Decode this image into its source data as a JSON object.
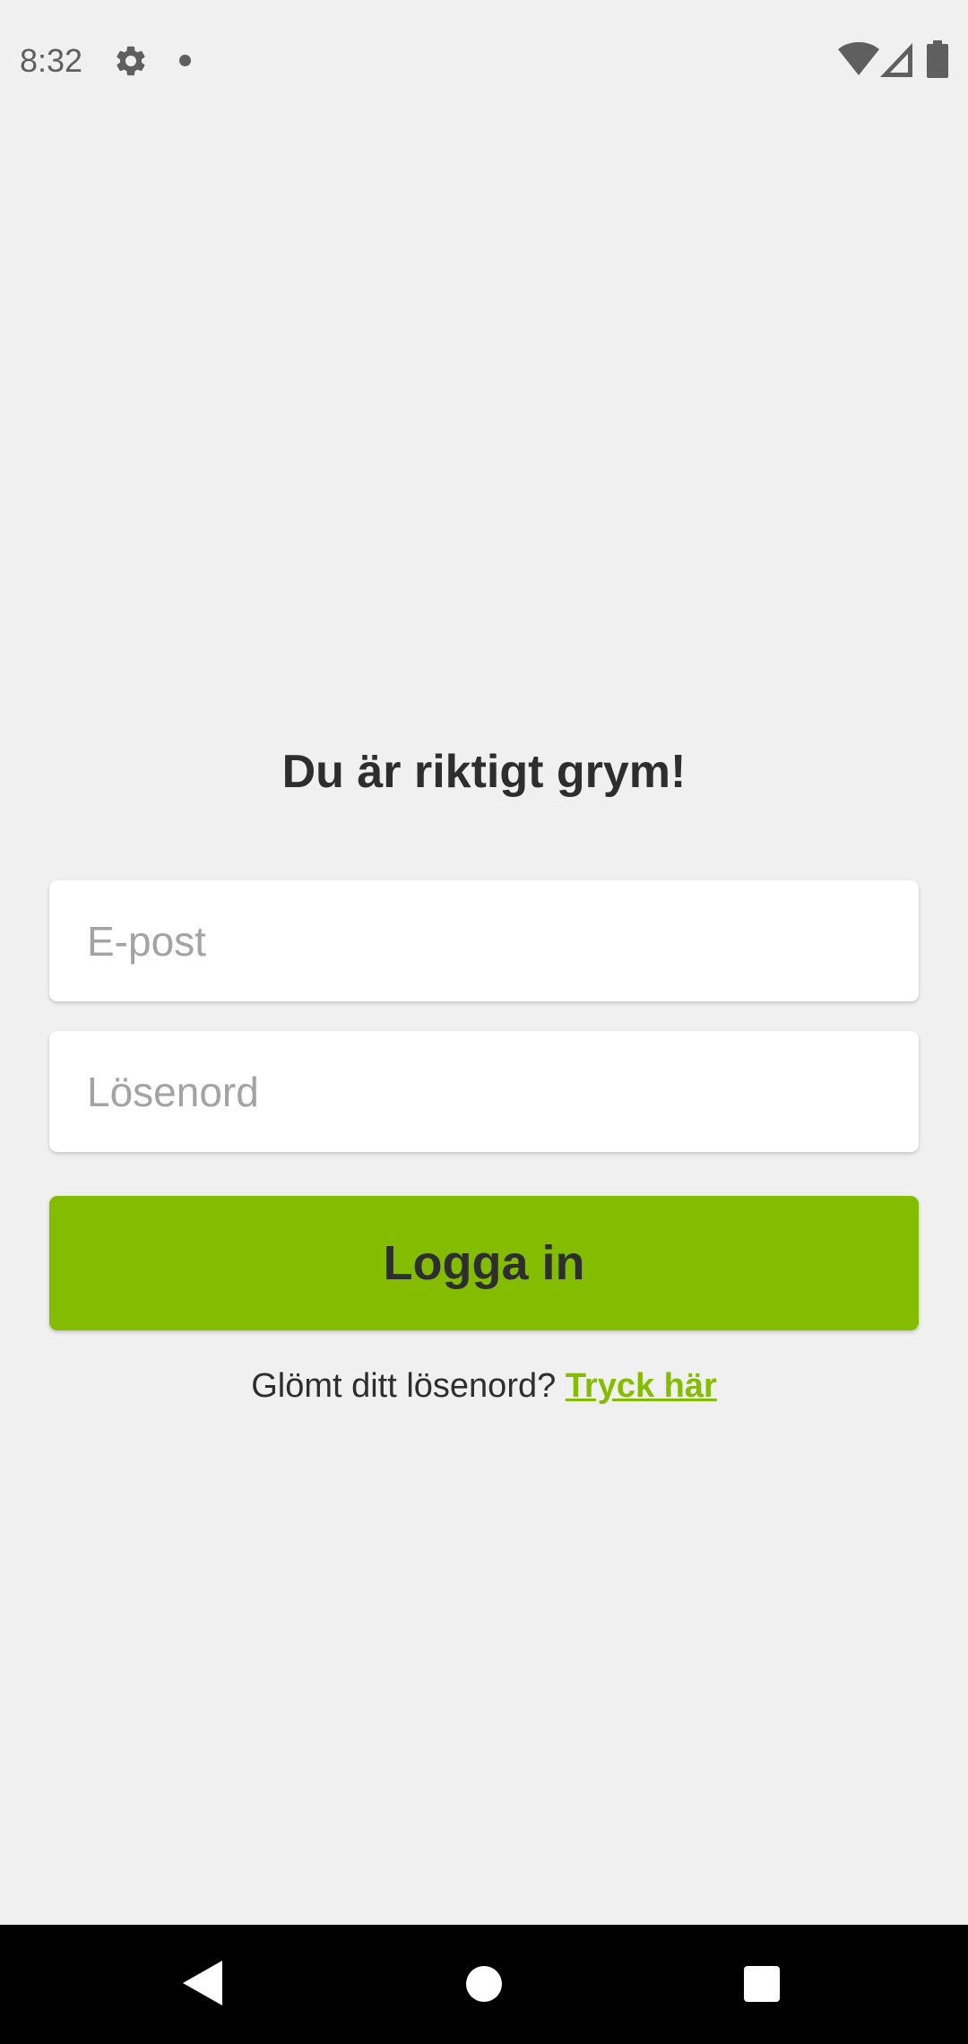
{
  "status_bar": {
    "time": "8:32",
    "icons": [
      "gear-icon",
      "notification-dot-icon",
      "wifi-icon",
      "signal-icon",
      "battery-icon"
    ],
    "icon_color": "#5f5f5f"
  },
  "login": {
    "heading": "Du är riktigt grym!",
    "email_placeholder": "E-post",
    "password_placeholder": "Lösenord",
    "submit_label": "Logga in",
    "forgot_text": "Glömt ditt lösenord?",
    "forgot_link": "Tryck här"
  },
  "nav_bar": {
    "icons": [
      "back-icon",
      "home-icon",
      "recents-icon"
    ]
  },
  "colors": {
    "accent": "#84bd00",
    "background": "#f0f0f0",
    "text": "#2e2e2e",
    "placeholder": "#a3a3a3"
  }
}
